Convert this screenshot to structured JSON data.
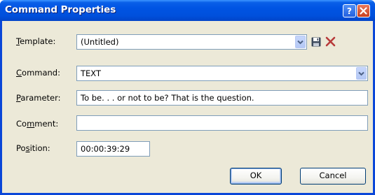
{
  "window": {
    "title": "Command Properties",
    "help_icon": "help-icon",
    "close_icon": "close-icon"
  },
  "template": {
    "label": "Template:",
    "mnemonic": "T",
    "value": "(Untitled)",
    "save_icon": "save-disk-icon",
    "delete_icon": "delete-x-icon",
    "delete_color": "#b73a3a"
  },
  "command": {
    "label": "Command:",
    "mnemonic": "C",
    "value": "TEXT"
  },
  "parameter": {
    "label": "Parameter:",
    "mnemonic": "P",
    "value": "To be. . .  or not to be? That is the question."
  },
  "comment": {
    "label": "Comment:",
    "mnemonic": "m",
    "value": ""
  },
  "position": {
    "label": "Position:",
    "mnemonic": "s",
    "value": "00:00:39:29"
  },
  "buttons": {
    "ok": "OK",
    "cancel": "Cancel"
  },
  "colors": {
    "titlebar": "#0054e3",
    "dialog_bg": "#ece9d8",
    "field_border": "#7f9db9"
  }
}
